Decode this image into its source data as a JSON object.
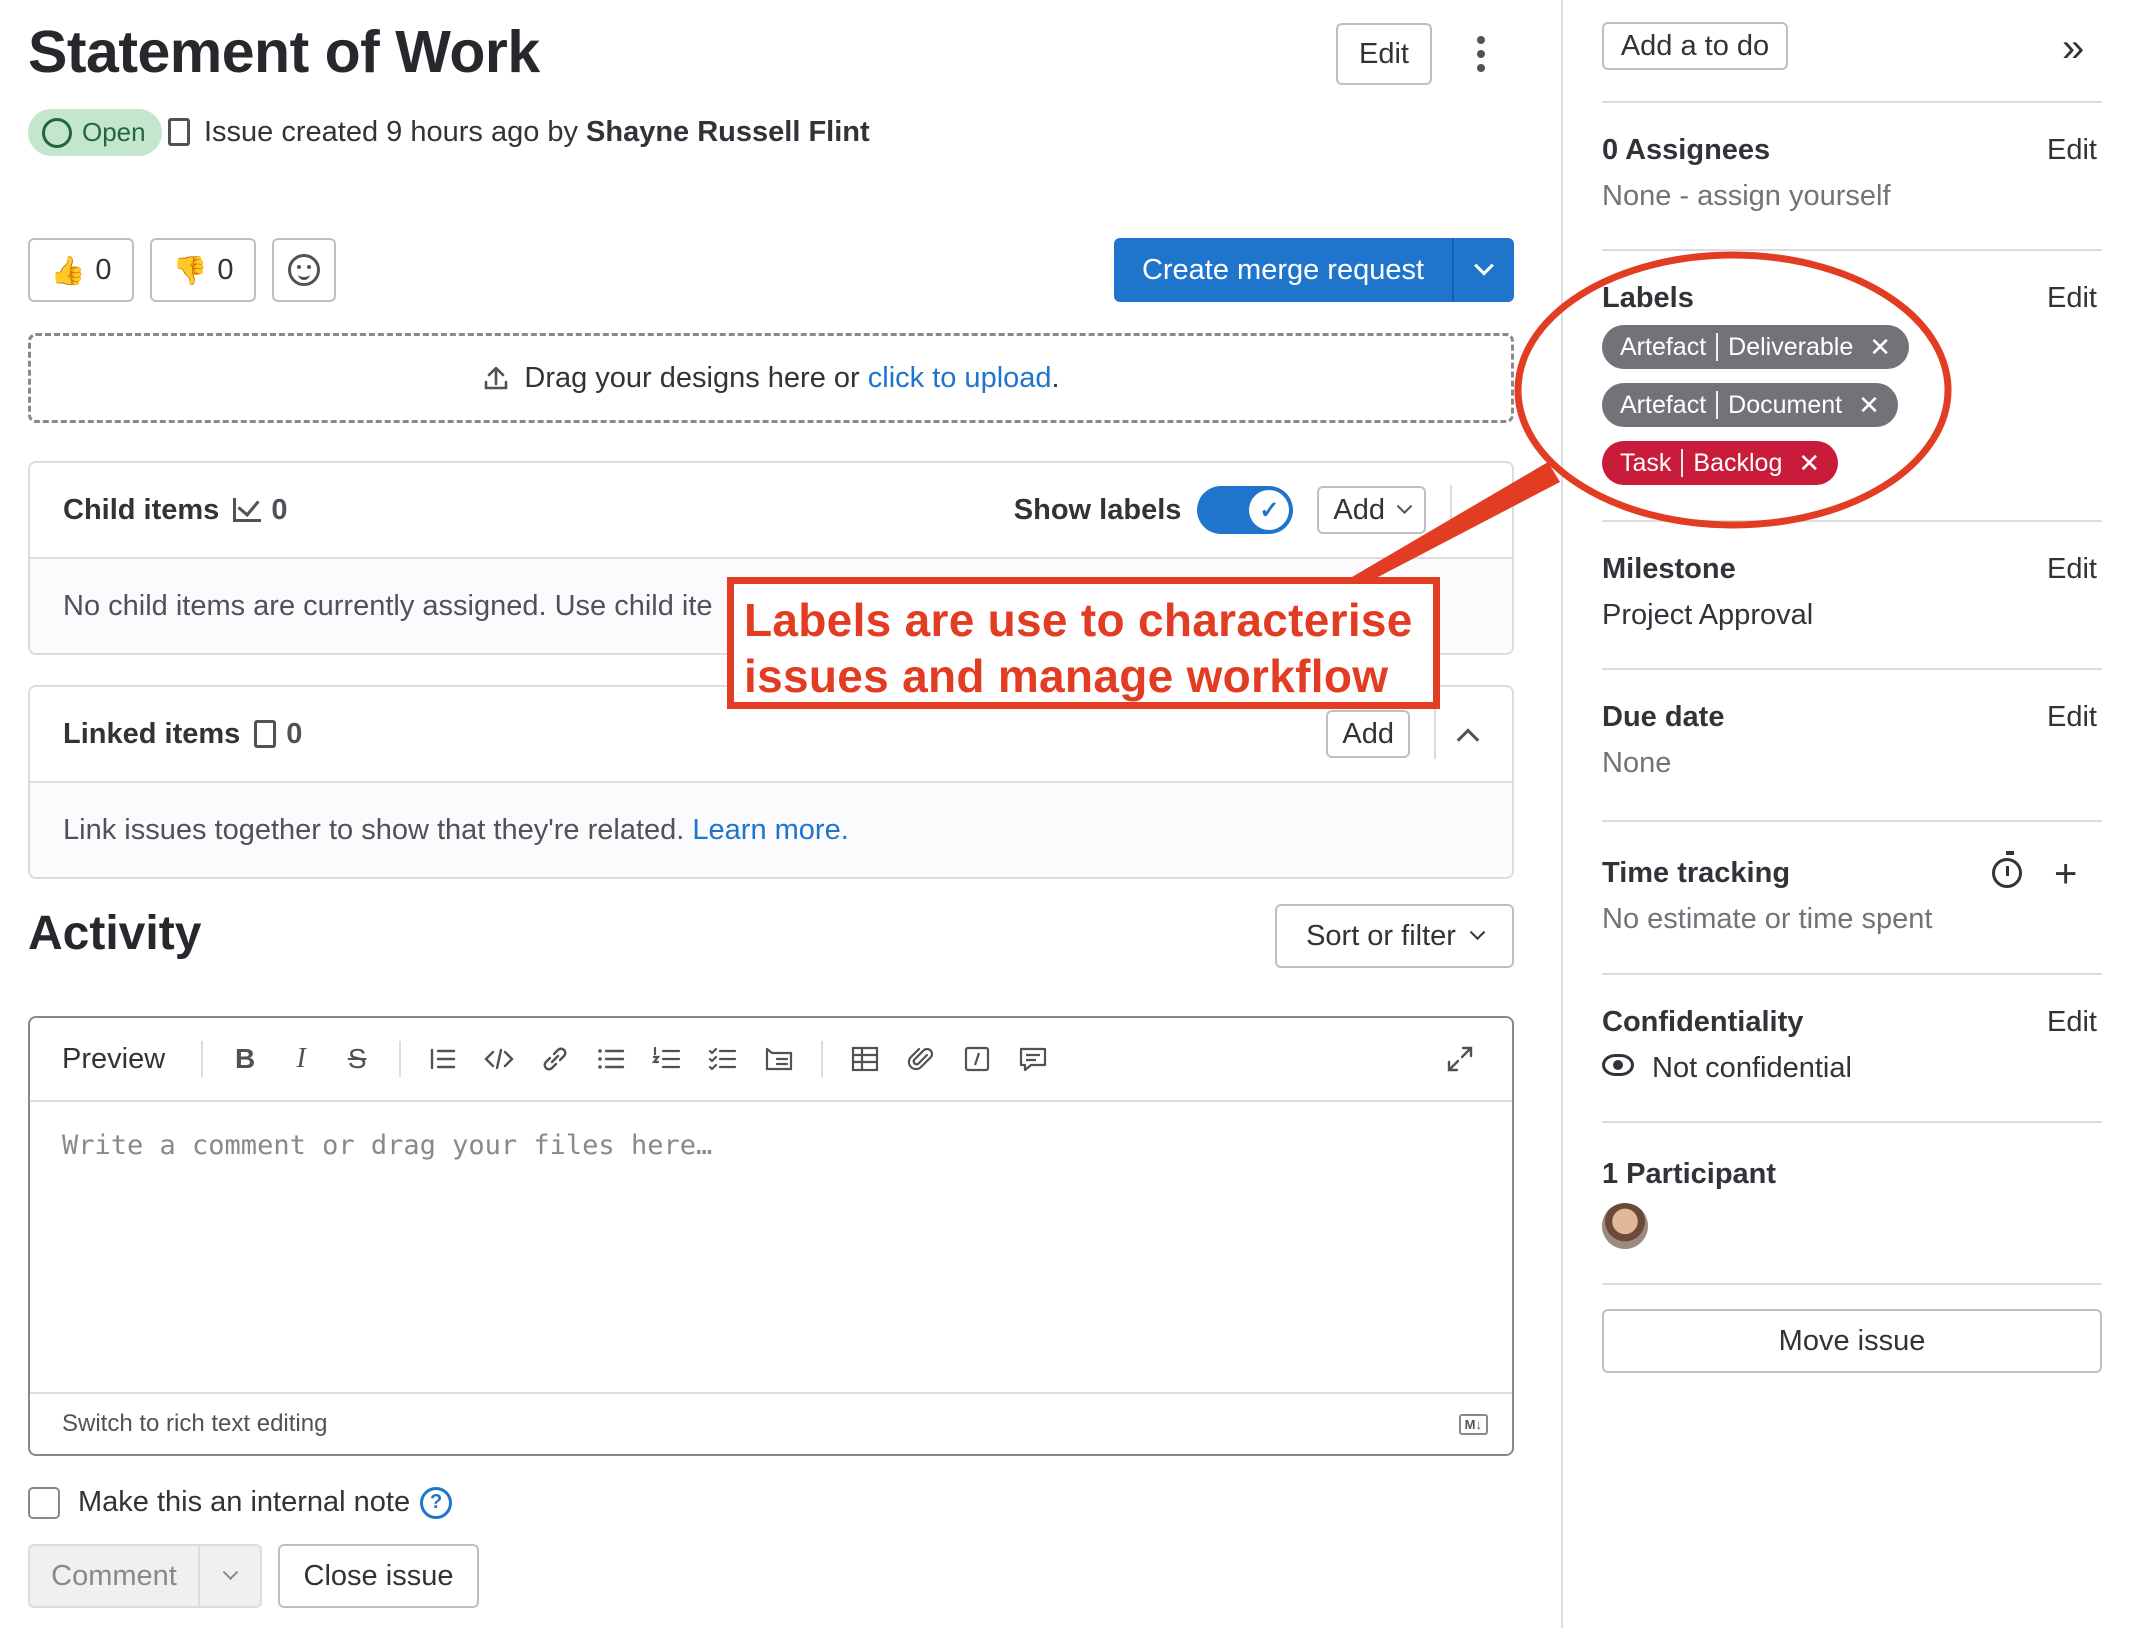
{
  "header": {
    "title": "Statement of Work",
    "edit_label": "Edit",
    "status": "Open",
    "meta_prefix": "Issue created 9 hours ago by",
    "author": "Shayne Russell Flint"
  },
  "reactions": {
    "thumbs_up": "0",
    "thumbs_down": "0"
  },
  "merge": {
    "label": "Create merge request"
  },
  "dropzone": {
    "text": "Drag your designs here or",
    "link": "click to upload",
    "suffix": "."
  },
  "child_items": {
    "title": "Child items",
    "count": "0",
    "show_labels": "Show labels",
    "add": "Add",
    "empty": "No child items are currently assigned. Use child ite"
  },
  "linked_items": {
    "title": "Linked items",
    "count": "0",
    "add": "Add",
    "empty": "Link issues together to show that they're related.",
    "learn_more": "Learn more."
  },
  "activity": {
    "title": "Activity",
    "sort_label": "Sort or filter",
    "preview": "Preview",
    "placeholder": "Write a comment or drag your files here…",
    "switch_rich": "Switch to rich text editing",
    "md": "M↓",
    "internal_note": "Make this an internal note",
    "comment": "Comment",
    "close_issue": "Close issue"
  },
  "sidebar": {
    "todo": "Add a to do",
    "assignees_title": "0 Assignees",
    "assignees_value": "None - assign yourself",
    "labels_title": "Labels",
    "labels": [
      {
        "scope": "Artefact",
        "name": "Deliverable",
        "color": "#737278"
      },
      {
        "scope": "Artefact",
        "name": "Document",
        "color": "#737278"
      },
      {
        "scope": "Task",
        "name": "Backlog",
        "color": "#c91c3a"
      }
    ],
    "milestone_title": "Milestone",
    "milestone_value": "Project Approval",
    "due_title": "Due date",
    "due_value": "None",
    "time_title": "Time tracking",
    "time_value": "No estimate or time spent",
    "confidentiality_title": "Confidentiality",
    "confidentiality_value": "Not confidential",
    "participants_title": "1 Participant",
    "move_issue": "Move issue",
    "edit": "Edit"
  },
  "annotation": {
    "line1": "Labels are use to characterise",
    "line2": "issues and manage workflow",
    "color": "#e23c22"
  },
  "colors": {
    "accent": "#1f75cb",
    "open_badge_bg": "#c3e6cd",
    "open_badge_fg": "#24663b"
  }
}
